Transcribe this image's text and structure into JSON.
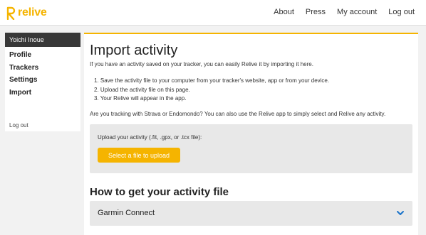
{
  "header": {
    "logo_text": "relive",
    "nav": [
      "About",
      "Press",
      "My account",
      "Log out"
    ]
  },
  "sidebar": {
    "user": "Yoichi Inoue",
    "items": [
      "Profile",
      "Trackers",
      "Settings",
      "Import"
    ],
    "logout": "Log out"
  },
  "main": {
    "title": "Import activity",
    "intro": "If you have an activity saved on your tracker, you can easily Relive it by importing it here.",
    "steps": [
      "1. Save the activity file to your computer from your tracker's website, app or from your device.",
      "2. Upload the activity file on this page.",
      "3. Your Relive will appear in the app."
    ],
    "strava_note": "Are you tracking with Strava or Endomondo? You can also use the Relive app to simply select and Relive any activity.",
    "upload": {
      "label": "Upload your activity (.fit, .gpx, or .tcx file):",
      "button": "Select a file to upload"
    },
    "how_title": "How to get your activity file",
    "accordion": [
      "Garmin Connect"
    ]
  },
  "colors": {
    "accent": "#f5b400",
    "link_blue": "#1a73c9"
  },
  "icons": {
    "logo": "relive-logo-icon",
    "expand": "chevron-down-icon"
  }
}
